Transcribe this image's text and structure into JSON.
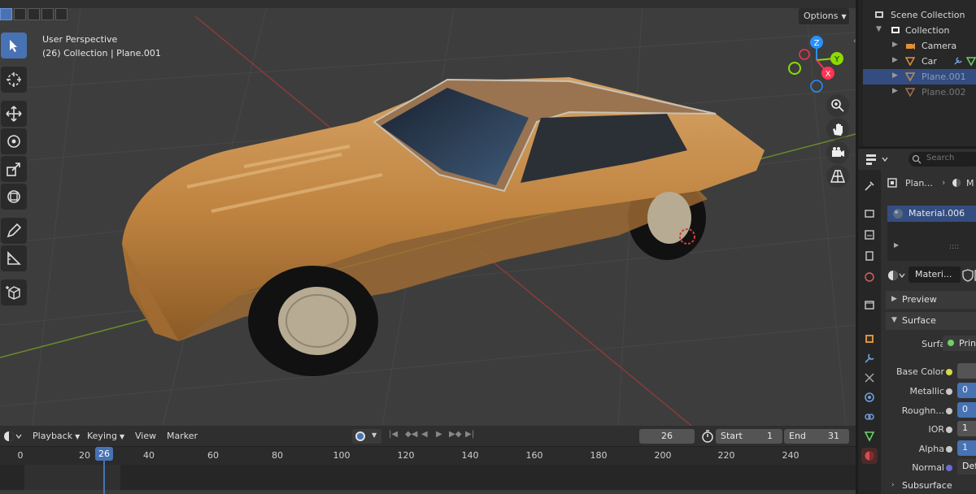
{
  "viewport": {
    "mode_line1": "User Perspective",
    "mode_line2": "(26) Collection | Plane.001",
    "options_label": "Options",
    "gizmo_axes": [
      "X",
      "Y",
      "Z"
    ],
    "colors": {
      "x_axis": "#ff3352",
      "y_axis": "#8bdc00",
      "z_axis": "#2890ff",
      "car_body": "#c28a45",
      "background": "#3d3d3d"
    }
  },
  "toolbar": {
    "tools": [
      {
        "name": "select-box-tool",
        "icon": "cursor-arrow-icon",
        "active": true
      },
      {
        "name": "cursor-tool",
        "icon": "crosshair-circle-icon",
        "active": false
      },
      {
        "name": "move-tool",
        "icon": "move-arrows-icon",
        "active": false
      },
      {
        "name": "rotate-tool",
        "icon": "rotate-icon",
        "active": false
      },
      {
        "name": "scale-tool",
        "icon": "scale-icon",
        "active": false
      },
      {
        "name": "transform-tool",
        "icon": "transform-icon",
        "active": false
      },
      {
        "name": "annotate-tool",
        "icon": "pencil-icon",
        "active": false
      },
      {
        "name": "measure-tool",
        "icon": "ruler-icon",
        "active": false
      },
      {
        "name": "add-cube-tool",
        "icon": "cube-add-icon",
        "active": false
      }
    ]
  },
  "timeline": {
    "menus": [
      "Playback",
      "Keying",
      "View",
      "Marker"
    ],
    "current_frame": "26",
    "start_label": "Start",
    "start_value": "1",
    "end_label": "End",
    "end_value": "31",
    "ruler": [
      "0",
      "20",
      "26",
      "40",
      "60",
      "80",
      "100",
      "120",
      "140",
      "160",
      "180",
      "200",
      "220",
      "240"
    ]
  },
  "outliner": {
    "rows": [
      {
        "label": "Scene Collection",
        "icon": "scene-collection-icon",
        "selected": false,
        "dim": false
      },
      {
        "label": "Collection",
        "icon": "collection-icon",
        "selected": false,
        "dim": false
      },
      {
        "label": "Camera",
        "icon": "camera-icon",
        "selected": false,
        "dim": false
      },
      {
        "label": "Car",
        "icon": "mesh-icon",
        "selected": false,
        "dim": false
      },
      {
        "label": "Plane.001",
        "icon": "mesh-icon",
        "selected": true,
        "dim": true
      },
      {
        "label": "Plane.002",
        "icon": "mesh-icon",
        "selected": false,
        "dim": true
      }
    ]
  },
  "properties": {
    "search_placeholder": "Search",
    "breadcrumb_object": "Plan...",
    "breadcrumb_more": "M",
    "material_slot": "Material.006",
    "material_name": "Materi...",
    "preview_label": "Preview",
    "surface_panel_label": "Surface",
    "surface_label": "Surface",
    "surface_value": "Princ",
    "rows": [
      {
        "label": "Base Color",
        "value": "",
        "style": "grey"
      },
      {
        "label": "Metallic",
        "value": "0",
        "style": "blue"
      },
      {
        "label": "Roughn...",
        "value": "0",
        "style": "blue"
      },
      {
        "label": "IOR",
        "value": "1",
        "style": "grey"
      },
      {
        "label": "Alpha",
        "value": "1",
        "style": "blue"
      },
      {
        "label": "Normal",
        "value": "Defa",
        "style": "dark"
      }
    ],
    "subsurface_label": "Subsurface"
  }
}
